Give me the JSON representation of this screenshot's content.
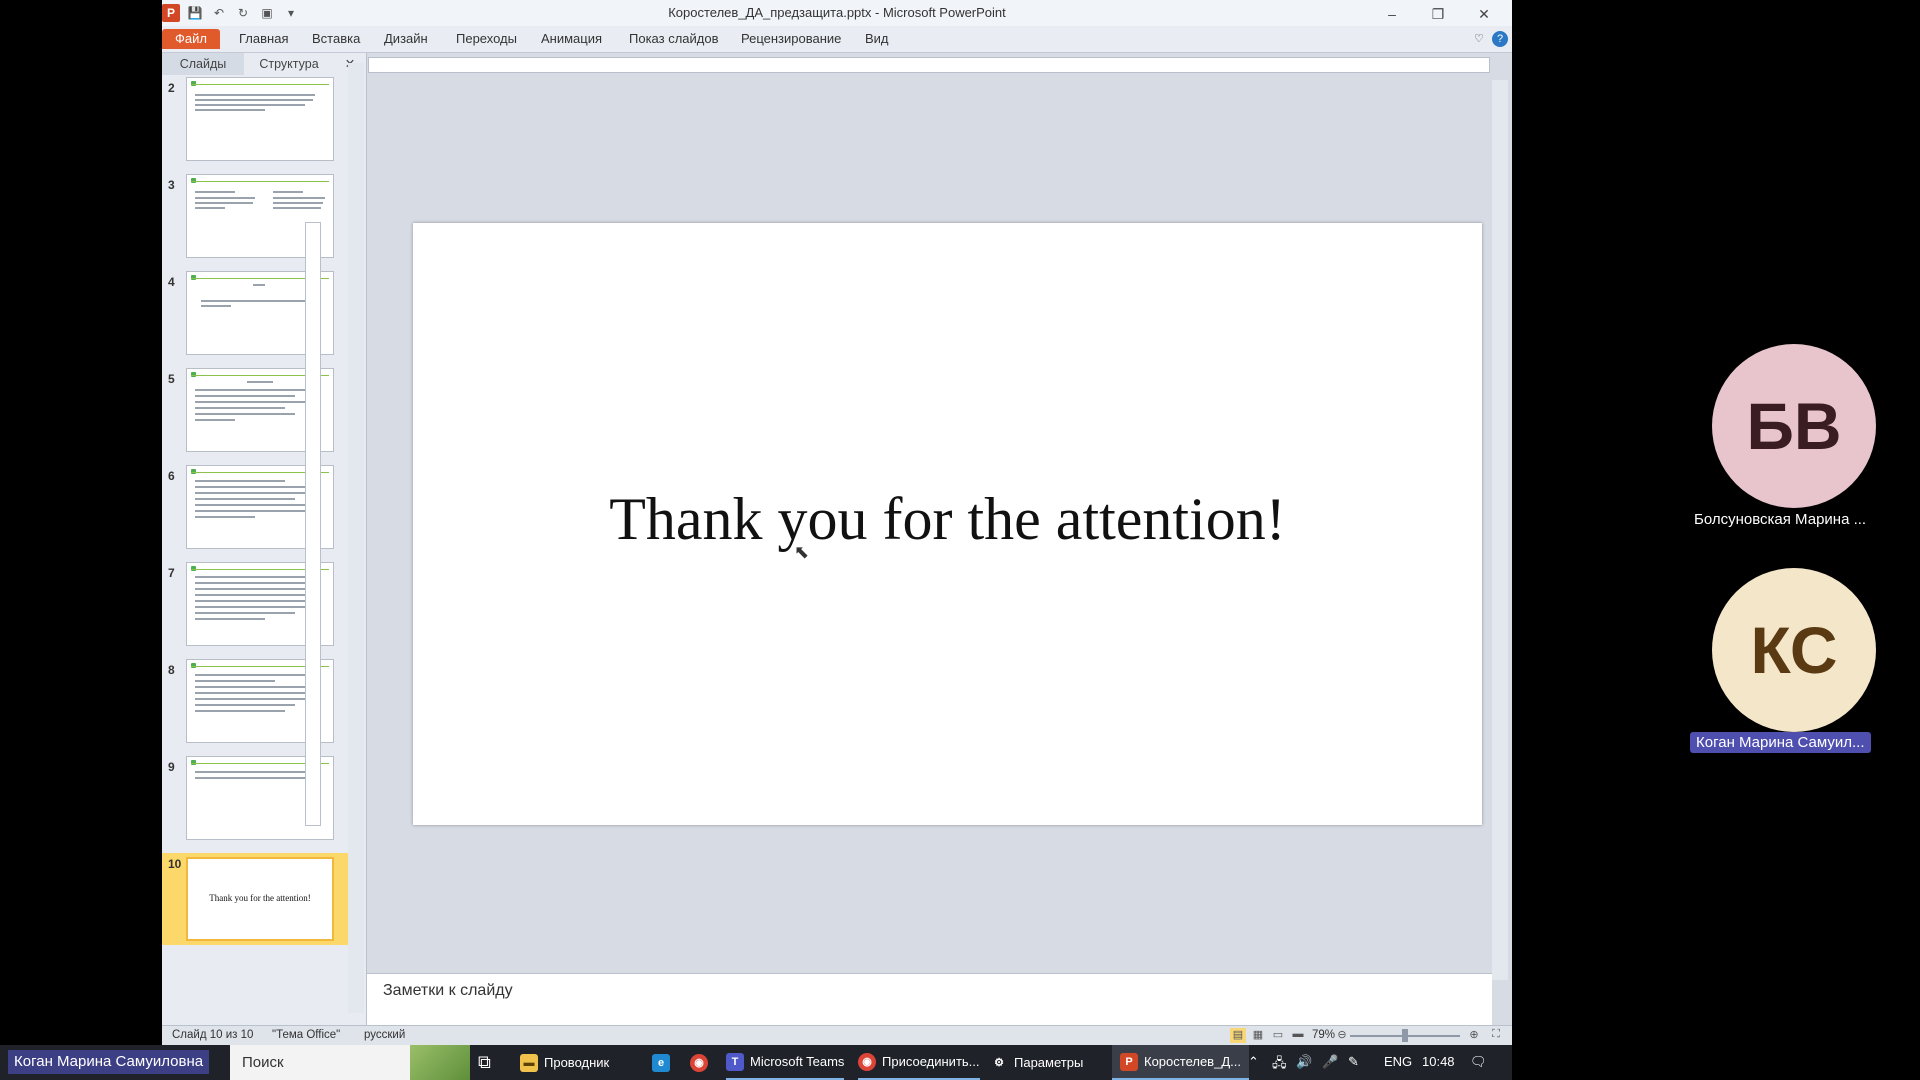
{
  "window": {
    "title": "Коростелев_ДА_предзащита.pptx - Microsoft PowerPoint",
    "minimize": "–",
    "restore": "❐",
    "close": "✕"
  },
  "ribbon": {
    "tabs": [
      "Файл",
      "Главная",
      "Вставка",
      "Дизайн",
      "Переходы",
      "Анимация",
      "Показ слайдов",
      "Рецензирование",
      "Вид"
    ]
  },
  "panel": {
    "tabs": [
      "Слайды",
      "Структура"
    ],
    "close": "✕"
  },
  "thumbnails": [
    {
      "num": "2"
    },
    {
      "num": "3"
    },
    {
      "num": "4"
    },
    {
      "num": "5"
    },
    {
      "num": "6"
    },
    {
      "num": "7"
    },
    {
      "num": "8"
    },
    {
      "num": "9"
    },
    {
      "num": "10",
      "text": "Thank you for the attention!"
    }
  ],
  "slide": {
    "text": "Thank you for the attention!"
  },
  "notes": {
    "placeholder": "Заметки к слайду"
  },
  "status": {
    "slide_info": "Слайд 10 из 10",
    "theme": "\"Тема Office\"",
    "language": "русский",
    "zoom": "79%"
  },
  "taskbar": {
    "presenter": "Коган Марина Самуиловна",
    "search": "Поиск",
    "items": [
      "Проводник",
      "Microsoft Teams",
      "Присоединить...",
      "Параметры",
      "Коростелев_Д..."
    ],
    "lang": "ENG",
    "time": "10:48"
  },
  "participants": [
    {
      "initials": "БВ",
      "name": "Болсуновская Марина ...",
      "bg": "#e8c4cc",
      "fg": "#3a1d22"
    },
    {
      "initials": "КС",
      "name": "Коган Марина Самуил...",
      "bg": "#f4e6c9",
      "fg": "#5a3a12"
    }
  ]
}
